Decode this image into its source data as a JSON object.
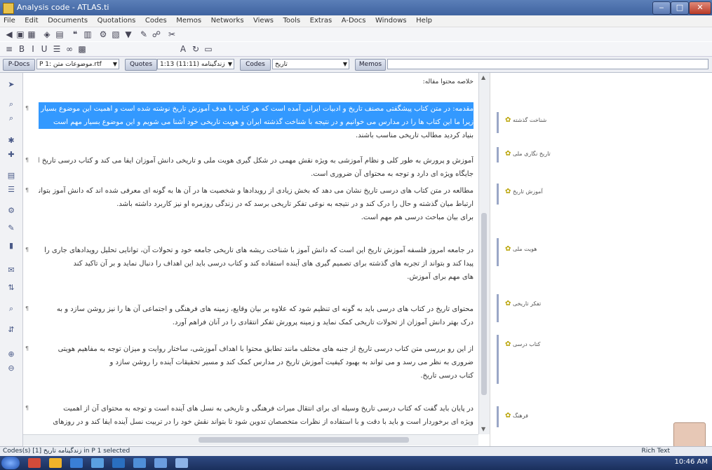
{
  "window": {
    "title": "Analysis code - ATLAS.ti"
  },
  "menu": [
    "File",
    "Edit",
    "Documents",
    "Quotations",
    "Codes",
    "Memos",
    "Networks",
    "Views",
    "Tools",
    "Extras",
    "A-Docs",
    "Windows",
    "Help"
  ],
  "selectors": {
    "pdoc_label": "P-Docs",
    "pdoc_value": "P 1: موضوعات متن.rtf",
    "quotes_label": "Quotes",
    "quotes_value": "1:13 (11:11) زندگینامه",
    "codes_label": "Codes",
    "codes_value": "تاریخ",
    "memos_label": "Memos"
  },
  "document": {
    "header_line": "خلاصه محتوا مقاله:",
    "paragraphs": [
      {
        "lines": [
          {
            "text": "مقدمه: در متن کتاب پیشگفتی مصنف تاریخ و ادبیات ایرانی آمده است که هر کتاب با هدف آموزش تاریخ نوشته شده است و اهمیت این موضوع بسیار است",
            "hl": true
          },
          {
            "text": "زیرا ما این کتاب ها را در مدارس می خوانیم و در نتیجه با شناخت گذشته ایران و هویت تاریخی خود آشنا می شویم و این موضوع بسیار مهم است",
            "hl": true
          },
          {
            "text": "بنیاد کردید مطالب تاریخی مناسب باشند.",
            "hl": false
          }
        ]
      },
      {
        "lines": [
          {
            "text": "آموزش و پرورش به طور کلی و نظام آموزشی به ویژه نقش مهمی در شکل گیری هویت ملی و تاریخی دانش آموزان ایفا می کند و کتاب درسی تاریخ از این جهت",
            "hl": false
          },
          {
            "text": "جایگاه ویژه ای دارد و توجه به محتوای آن ضروری است.",
            "hl": false
          }
        ]
      },
      {
        "lines": [
          {
            "text": "مطالعه در متن کتاب های درسی تاریخ نشان می دهد که بخش زیادی از رویدادها و شخصیت ها در آن ها به گونه ای معرفی شده اند که دانش آموز بتواند",
            "hl": false
          },
          {
            "text": "ارتباط میان گذشته و حال را درک کند و در نتیجه به نوعی تفکر تاریخی برسد که در زندگی روزمره او نیز کاربرد داشته باشد.",
            "hl": false
          },
          {
            "text": "برای بیان مباحث درسی هم مهم است.",
            "hl": false
          }
        ]
      },
      {
        "lines": [
          {
            "text": "در جامعه امروز فلسفه آموزش تاریخ این است که دانش آموز با شناخت ریشه های تاریخی جامعه خود و تحولات آن، توانایی تحلیل رویدادهای جاری را",
            "hl": false
          },
          {
            "text": "پیدا کند و بتواند از تجربه های گذشته برای تصمیم گیری های آینده استفاده کند و کتاب درسی باید این اهداف را دنبال نماید و بر آن تاکید کند",
            "hl": false
          },
          {
            "text": "های مهم برای آموزش.",
            "hl": false
          }
        ]
      },
      {
        "lines": [
          {
            "text": "محتوای تاریخ در کتاب های درسی باید به گونه ای تنظیم شود که علاوه بر بیان وقایع، زمینه های فرهنگی و اجتماعی آن ها را نیز روشن سازد و به",
            "hl": false
          },
          {
            "text": "درک بهتر دانش آموزان از تحولات تاریخی کمک نماید و زمینه پرورش تفکر انتقادی را در آنان فراهم آورد.",
            "hl": false
          }
        ]
      },
      {
        "lines": [
          {
            "text": "از این رو بررسی متن کتاب درسی تاریخ از جنبه های مختلف مانند تطابق محتوا با اهداف آموزشی، ساختار روایت و میزان توجه به مفاهیم هویتی",
            "hl": false
          },
          {
            "text": "ضروری به نظر می رسد و می تواند به بهبود کیفیت آموزش تاریخ در مدارس کمک کند و مسیر تحقیقات آینده را روشن سازد و",
            "hl": false
          },
          {
            "text": "کتاب درسی تاریخ.",
            "hl": false
          }
        ]
      },
      {
        "lines": [
          {
            "text": "در پایان باید گفت که کتاب درسی تاریخ وسیله ای برای انتقال میراث فرهنگی و تاریخی به نسل های آینده است و توجه به محتوای آن از اهمیت",
            "hl": false
          },
          {
            "text": "ویژه ای برخوردار است و باید با دقت و با استفاده از نظرات متخصصان تدوین شود تا بتواند نقش خود را در تربیت نسل آینده ایفا کند و در روزهای",
            "hl": false
          }
        ]
      }
    ]
  },
  "codes_margin": [
    {
      "label": "شناخت گذشته",
      "icon": "code-icon"
    },
    {
      "label": "تاریخ نگاری ملی",
      "icon": "code-icon"
    },
    {
      "label": "آموزش تاریخ",
      "icon": "code-icon"
    },
    {
      "label": "هویت ملی",
      "icon": "code-icon"
    },
    {
      "label": "تفکر تاریخی",
      "icon": "code-icon"
    },
    {
      "label": "کتاب درسی",
      "icon": "code-icon"
    },
    {
      "label": "فرهنگ",
      "icon": "code-icon"
    }
  ],
  "status": {
    "left": "Codes(s) زندگینامه تاریخ [1] in P 1 selected",
    "right": "Rich Text"
  },
  "taskbar": {
    "time": "10:46 AM"
  }
}
